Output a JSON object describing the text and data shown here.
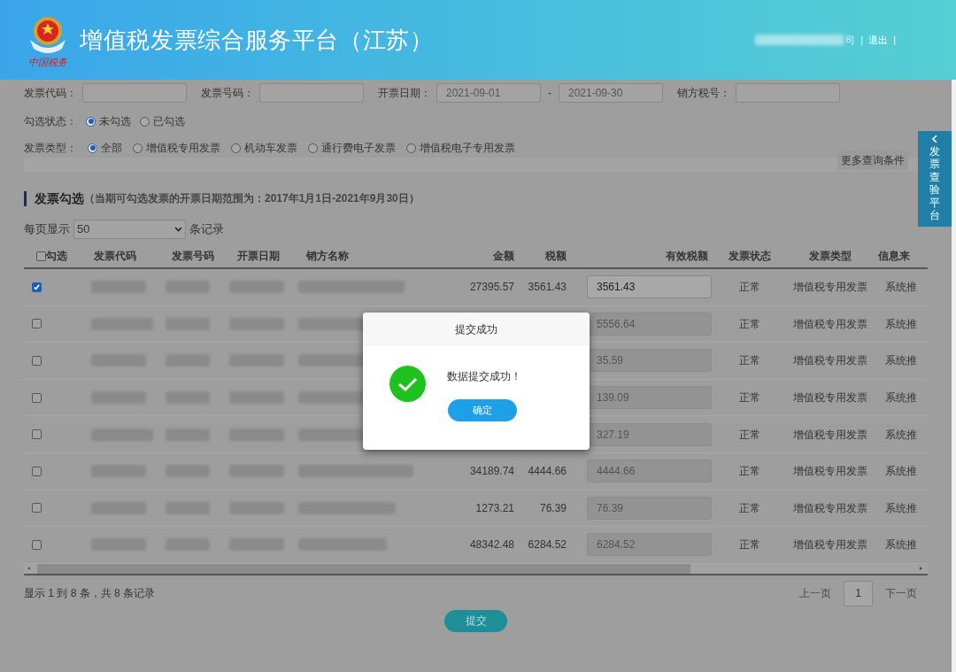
{
  "header": {
    "emblem_text": "中国税务",
    "title": "增值税发票综合服务平台（江苏）",
    "user_suffix": "司",
    "separator": "|",
    "logout": "退出"
  },
  "filters": {
    "fields": [
      {
        "label": "发票代码："
      },
      {
        "label": "发票号码："
      },
      {
        "label": "开票日期：",
        "value": "2021-09-01",
        "range_separator": "-",
        "value_end": "2021-09-30"
      },
      {
        "label": "销方税号："
      }
    ],
    "check_status": {
      "label": "勾选状态：",
      "options": [
        {
          "label": "未勾选",
          "selected": true
        },
        {
          "label": "已勾选",
          "selected": false
        }
      ]
    },
    "invoice_type": {
      "label": "发票类型：",
      "options": [
        {
          "label": "全部",
          "selected": true
        },
        {
          "label": "增值税专用发票",
          "selected": false
        },
        {
          "label": "机动车发票",
          "selected": false
        },
        {
          "label": "通行费电子发票",
          "selected": false
        },
        {
          "label": "增值税电子专用发票",
          "selected": false
        }
      ]
    },
    "more_button": "更多查询条件"
  },
  "side_tab": {
    "label": "发票查验平台"
  },
  "section": {
    "title": "发票勾选",
    "note": "（当期可勾选发票的开票日期范围为：2017年1月1日-2021年9月30日）"
  },
  "page_size": {
    "label": "每页显示",
    "value": "50",
    "suffix": "条记录"
  },
  "table": {
    "columns": [
      "勾选",
      "发票代码",
      "发票号码",
      "开票日期",
      "销方名称",
      "金额",
      "税额",
      "有效税额",
      "发票状态",
      "发票类型",
      "信息来"
    ],
    "header_checked": false,
    "rows": [
      {
        "checked": true,
        "amount": "27395.57",
        "tax": "3561.43",
        "effective_tax": "3561.43",
        "status": "正常",
        "type": "增值税专用发票",
        "source": "系统推"
      },
      {
        "checked": false,
        "effective_tax": "5556.64",
        "status": "正常",
        "type": "增值税专用发票",
        "source": "系统推"
      },
      {
        "checked": false,
        "effective_tax": "35.59",
        "status": "正常",
        "type": "增值税专用发票",
        "source": "系统推"
      },
      {
        "checked": false,
        "effective_tax": "139.09",
        "status": "正常",
        "type": "增值税专用发票",
        "source": "系统推"
      },
      {
        "checked": false,
        "effective_tax": "327.19",
        "status": "正常",
        "type": "增值税专用发票",
        "source": "系统推"
      },
      {
        "checked": false,
        "amount": "34189.74",
        "tax": "4444.66",
        "effective_tax": "4444.66",
        "status": "正常",
        "type": "增值税专用发票",
        "source": "系统推"
      },
      {
        "checked": false,
        "amount": "1273.21",
        "tax": "76.39",
        "effective_tax": "76.39",
        "status": "正常",
        "type": "增值税专用发票",
        "source": "系统推"
      },
      {
        "checked": false,
        "amount": "48342.48",
        "tax": "6284.52",
        "effective_tax": "6284.52",
        "status": "正常",
        "type": "增值税专用发票",
        "source": "系统推"
      }
    ]
  },
  "pagination": {
    "summary": "显示 1 到 8 条，共 8 条记录",
    "prev": "上一页",
    "pages": [
      {
        "label": "1",
        "selected": true
      }
    ],
    "next": "下一页"
  },
  "submit_button": "提交",
  "dialog": {
    "title": "提交成功",
    "message": "数据提交成功！",
    "ok": "确定"
  }
}
